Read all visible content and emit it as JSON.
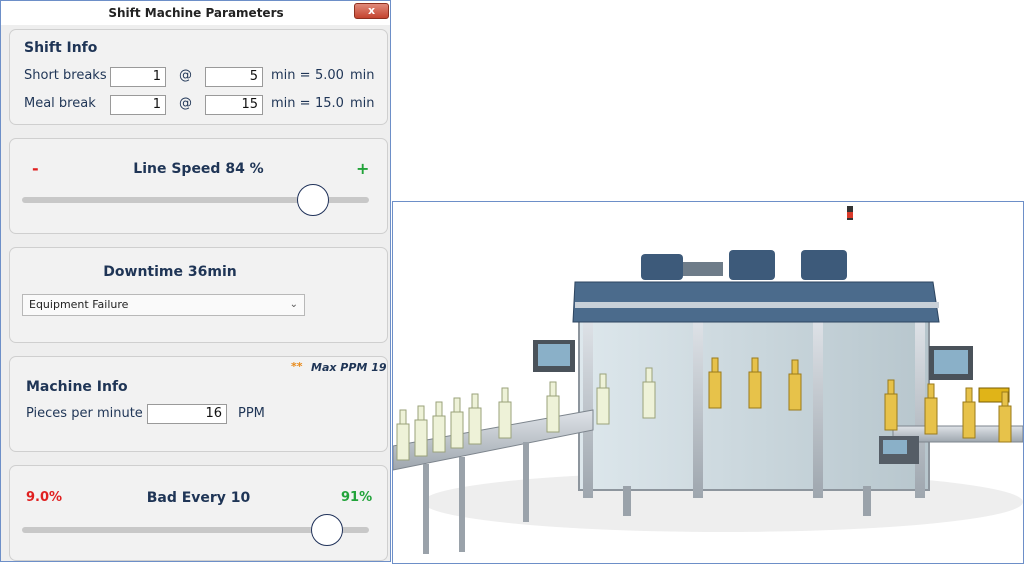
{
  "window": {
    "title": "Shift Machine Parameters",
    "close_symbol": "x"
  },
  "shift_info": {
    "title": "Shift Info",
    "short_breaks": {
      "label": "Short breaks",
      "count": "1",
      "at": "@",
      "minutes": "5",
      "eq": "min =",
      "total": "5.00",
      "unit": "min"
    },
    "meal_break": {
      "label": "Meal break",
      "count": "1",
      "at": "@",
      "minutes": "15",
      "eq": "min =",
      "total": "15.0",
      "unit": "min"
    }
  },
  "line_speed": {
    "minus": "-",
    "plus": "+",
    "label": "Line Speed 84 %",
    "value_percent": 84
  },
  "downtime": {
    "title": "Downtime 36min",
    "reason": "Equipment Failure"
  },
  "machine_info": {
    "note_marker": "**",
    "max_ppm": "Max PPM 19",
    "title": "Machine Info",
    "ppm_label": "Pieces per minute",
    "ppm_value": "16",
    "ppm_unit": "PPM"
  },
  "quality": {
    "bad_percent": "9.0%",
    "label": "Bad Every 10",
    "good_percent": "91%",
    "slider_fraction": 0.88
  },
  "colors": {
    "accent": "#1f3556",
    "minus": "#e02020",
    "plus": "#22a33a",
    "note": "#e88a1a"
  },
  "photo": {
    "description_icon": "bottling-machine-image"
  }
}
